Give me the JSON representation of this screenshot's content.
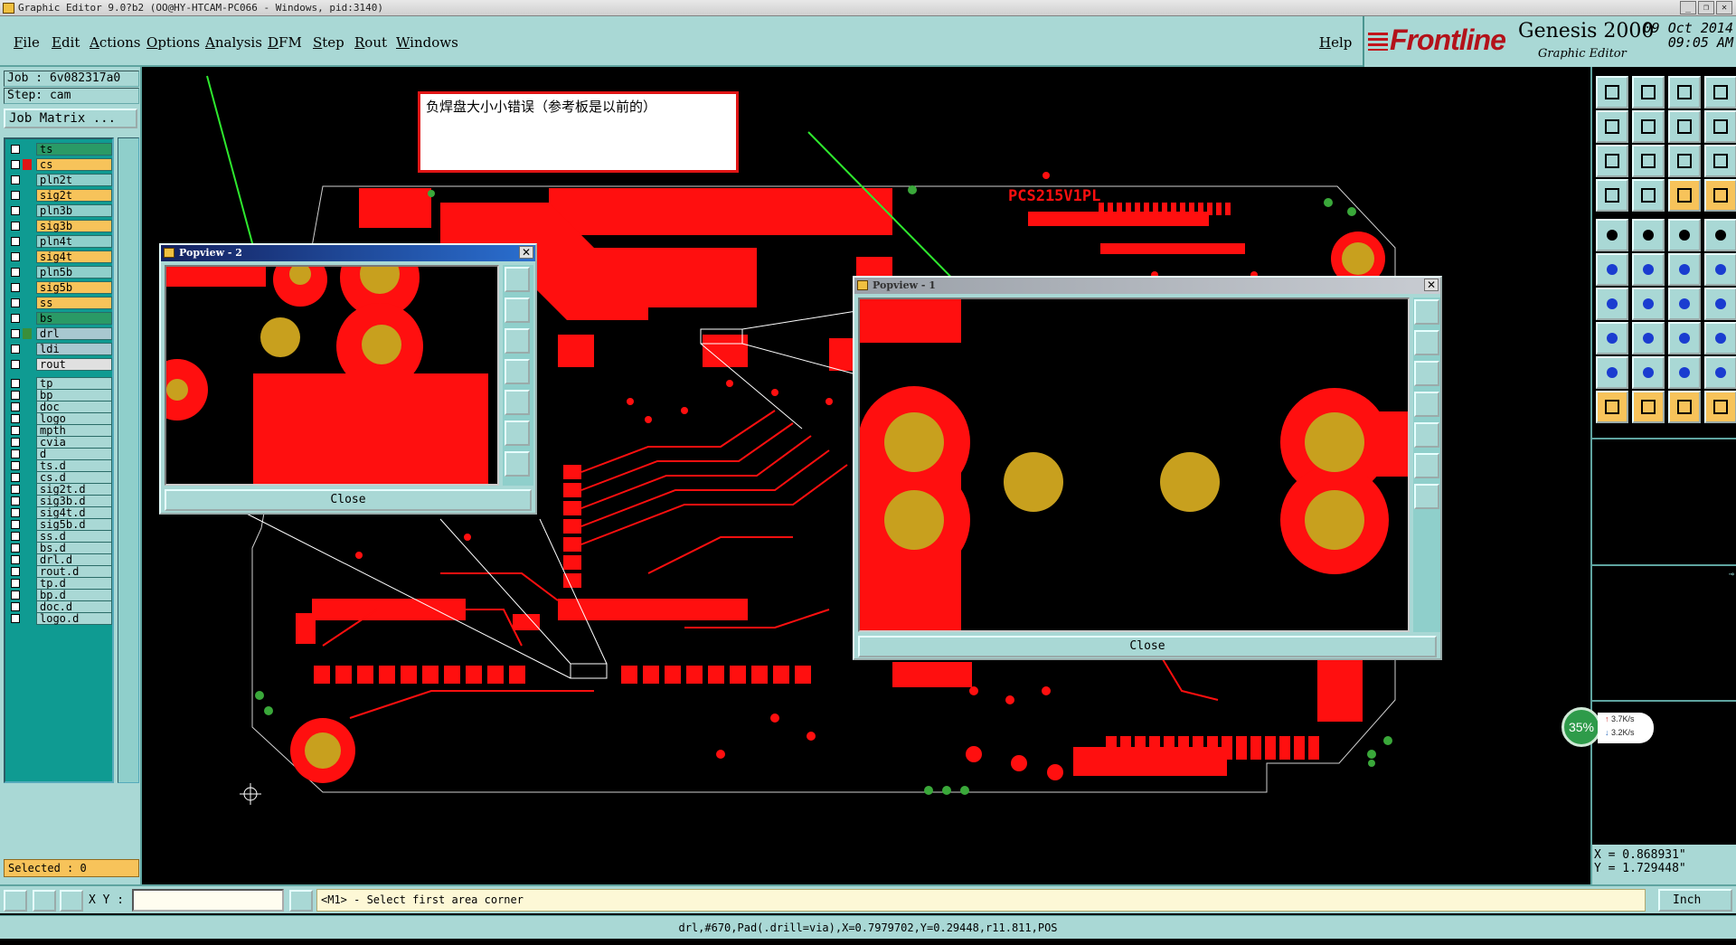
{
  "window": {
    "title": "Graphic Editor 9.0?b2 (OO@HY-HTCAM-PC066 - Windows, pid:3140)"
  },
  "menu": [
    "File",
    "Edit",
    "Actions",
    "Options",
    "Analysis",
    "DFM",
    "Step",
    "Rout",
    "Windows"
  ],
  "help_label": "Help",
  "brand": {
    "logo": "Frontline",
    "product": "Genesis 2000",
    "subtitle": "Graphic Editor",
    "date": "09 Oct 2014",
    "time": "09:05 AM"
  },
  "job": {
    "job_label": "Job : 6v082317a0",
    "step_label": "Step: cam",
    "matrix_button": "Job Matrix ..."
  },
  "layers": [
    {
      "name": "ts",
      "color": "#2a9a66",
      "swatch": ""
    },
    {
      "name": "cs",
      "color": "#f7c35a",
      "swatch": "#e01515",
      "active": true
    },
    {
      "name": "pln2t",
      "color": "#8fcfcb",
      "swatch": ""
    },
    {
      "name": "sig2t",
      "color": "#f7c35a",
      "swatch": ""
    },
    {
      "name": "pln3b",
      "color": "#8fcfcb",
      "swatch": ""
    },
    {
      "name": "sig3b",
      "color": "#f7c35a",
      "swatch": ""
    },
    {
      "name": "pln4t",
      "color": "#8fcfcb",
      "swatch": ""
    },
    {
      "name": "sig4t",
      "color": "#f7c35a",
      "swatch": ""
    },
    {
      "name": "pln5b",
      "color": "#8fcfcb",
      "swatch": ""
    },
    {
      "name": "sig5b",
      "color": "#f7c35a",
      "swatch": ""
    },
    {
      "name": "ss",
      "color": "#f7c35a",
      "swatch": ""
    },
    {
      "name": "bs",
      "color": "#2a9a66",
      "swatch": ""
    },
    {
      "name": "drl",
      "color": "#a8c8d0",
      "swatch": "#3a8f3a"
    },
    {
      "name": "ldi",
      "color": "#a8c8d0",
      "swatch": ""
    },
    {
      "name": "rout",
      "color": "#e0e0e0",
      "swatch": ""
    },
    {
      "name": "tp",
      "color": "#a9d8d5",
      "swatch": ""
    },
    {
      "name": "bp",
      "color": "#a9d8d5",
      "swatch": ""
    },
    {
      "name": "doc",
      "color": "#a9d8d5",
      "swatch": ""
    },
    {
      "name": "logo",
      "color": "#a9d8d5",
      "swatch": ""
    },
    {
      "name": "mpth",
      "color": "#a9d8d5",
      "swatch": ""
    },
    {
      "name": "cvia",
      "color": "#a9d8d5",
      "swatch": ""
    },
    {
      "name": "d",
      "color": "#a9d8d5",
      "swatch": ""
    },
    {
      "name": "ts.d",
      "color": "#a9d8d5",
      "swatch": ""
    },
    {
      "name": "cs.d",
      "color": "#a9d8d5",
      "swatch": ""
    },
    {
      "name": "sig2t.d",
      "color": "#a9d8d5",
      "swatch": ""
    },
    {
      "name": "sig3b.d",
      "color": "#a9d8d5",
      "swatch": ""
    },
    {
      "name": "sig4t.d",
      "color": "#a9d8d5",
      "swatch": ""
    },
    {
      "name": "sig5b.d",
      "color": "#a9d8d5",
      "swatch": ""
    },
    {
      "name": "ss.d",
      "color": "#a9d8d5",
      "swatch": ""
    },
    {
      "name": "bs.d",
      "color": "#a9d8d5",
      "swatch": ""
    },
    {
      "name": "drl.d",
      "color": "#a9d8d5",
      "swatch": ""
    },
    {
      "name": "rout.d",
      "color": "#a9d8d5",
      "swatch": ""
    },
    {
      "name": "tp.d",
      "color": "#a9d8d5",
      "swatch": ""
    },
    {
      "name": "bp.d",
      "color": "#a9d8d5",
      "swatch": ""
    },
    {
      "name": "doc.d",
      "color": "#a9d8d5",
      "swatch": ""
    },
    {
      "name": "logo.d",
      "color": "#a9d8d5",
      "swatch": ""
    }
  ],
  "selected_label": "Selected : 0",
  "annotation": {
    "text": "负焊盘大小小错误（参考板是以前的）"
  },
  "board_label": "PCS215V1PL",
  "popview2": {
    "title": "Popview - 2",
    "close_label": "Close"
  },
  "popview1": {
    "title": "Popview - 1",
    "close_label": "Close"
  },
  "coords": {
    "x": "X = 0.868931\"",
    "y": "Y = 1.729448\""
  },
  "net_speed": {
    "percent": "35%",
    "up": "3.7K/s",
    "down": "3.2K/s"
  },
  "status": {
    "xy_label": "X Y :",
    "xy_value": "",
    "prompt": "<M1> - Select first area corner",
    "unit": "Inch"
  },
  "info_line": "drl,#670,Pad(.drill=via),X=0.7979702,Y=0.29448,r11.811,POS",
  "colors": {
    "panel": "#a9d8d5",
    "copper": "#ff0f0f",
    "drill": "#c8a01e",
    "arrow": "#2ee82e"
  }
}
